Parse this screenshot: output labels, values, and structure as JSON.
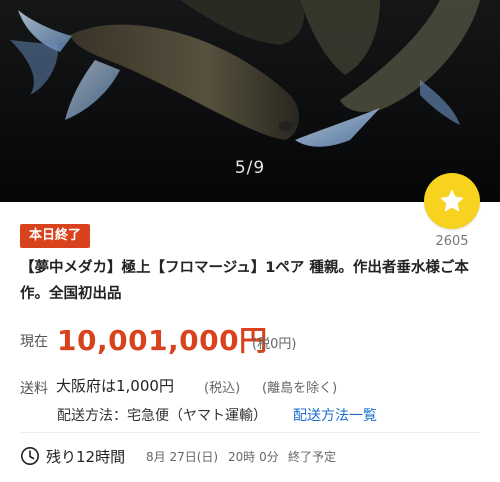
{
  "gallery": {
    "counter": "5/9",
    "image_icon": "medaka-fish-photo"
  },
  "watch": {
    "icon": "star-icon",
    "count": "2605",
    "color": "#f7d21e"
  },
  "badge": {
    "label": "本日終了",
    "color": "#d8421c"
  },
  "item": {
    "title": "【夢中メダカ】極上【フロマージュ】1ペア 種親。作出者垂水様ご本作。全国初出品"
  },
  "price": {
    "label": "現在",
    "value": "10,001,000円",
    "tax": "(税0円)",
    "color": "#d8431d"
  },
  "shipping": {
    "label": "送料",
    "value": "大阪府は1,000円",
    "tax": "(税込)",
    "note": "(離島を除く)",
    "method": "配送方法：宅急便（ヤマト運輸）",
    "method_link": "配送方法一覧",
    "link_color": "#1a6fcf"
  },
  "remaining": {
    "icon": "clock-icon",
    "text": "残り12時間",
    "end_date": "8月 27日(日)",
    "end_time": "20時 0分",
    "end_note": "終了予定"
  }
}
